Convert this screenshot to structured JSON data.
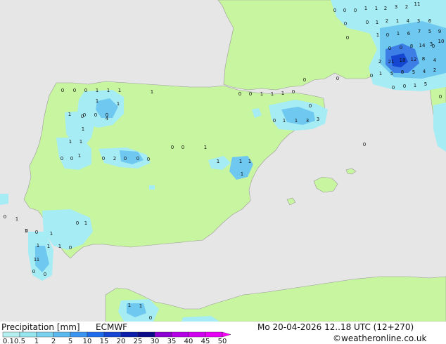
{
  "title": "Precipitation [mm]",
  "model": "ECMWF",
  "valid_time": "Mo 20-04-2026 12..18 UTC (12+270)",
  "credit": "©weatheronline.co.uk",
  "legend": {
    "ticks": [
      "0.1",
      "0.5",
      "1",
      "2",
      "5",
      "10",
      "15",
      "20",
      "25",
      "30",
      "35",
      "40",
      "45",
      "50"
    ],
    "colors": [
      "#b4f0f0",
      "#96e6f0",
      "#78d2f0",
      "#5ab9f0",
      "#3c96f0",
      "#1e6eeb",
      "#1446d2",
      "#0a1eaa",
      "#0a0a87",
      "#8c00d2",
      "#b400e6",
      "#d200f0",
      "#e600f5",
      "#ff00ff"
    ]
  },
  "colors": {
    "sea": "#e6e6e6",
    "land": "#c8f5a0",
    "light_precip": "#a6ecf4",
    "medium_precip": "#6ec8f0",
    "heavy_precip": "#3c7ee6"
  },
  "values": [
    {
      "v": "0"
    },
    {
      "v": "0"
    },
    {
      "v": "0"
    },
    {
      "v": "1"
    },
    {
      "v": "1"
    },
    {
      "v": "2"
    },
    {
      "v": "3"
    },
    {
      "v": "2"
    },
    {
      "v": "11"
    },
    {
      "v": "0"
    },
    {
      "v": "0"
    },
    {
      "v": "1"
    },
    {
      "v": "2"
    },
    {
      "v": "1"
    },
    {
      "v": "4"
    },
    {
      "v": "3"
    },
    {
      "v": "6"
    },
    {
      "v": "1"
    },
    {
      "v": "0"
    },
    {
      "v": "1"
    },
    {
      "v": "6"
    },
    {
      "v": "7"
    },
    {
      "v": "5"
    },
    {
      "v": "9"
    },
    {
      "v": "0"
    },
    {
      "v": "0"
    },
    {
      "v": "0"
    },
    {
      "v": "8"
    },
    {
      "v": "14"
    },
    {
      "v": "3"
    },
    {
      "v": "10"
    },
    {
      "v": "2"
    },
    {
      "v": "21"
    },
    {
      "v": "18"
    },
    {
      "v": "12"
    },
    {
      "v": "8"
    },
    {
      "v": "4"
    },
    {
      "v": "1"
    },
    {
      "v": "5"
    },
    {
      "v": "8"
    },
    {
      "v": "5"
    },
    {
      "v": "4"
    },
    {
      "v": "2"
    },
    {
      "v": "0"
    },
    {
      "v": "0"
    },
    {
      "v": "1"
    },
    {
      "v": "5"
    },
    {
      "v": "0"
    },
    {
      "v": "0"
    },
    {
      "v": "0"
    },
    {
      "v": "0"
    },
    {
      "v": "0"
    },
    {
      "v": "0"
    },
    {
      "v": "0"
    },
    {
      "v": "1"
    },
    {
      "v": "1"
    },
    {
      "v": "1"
    },
    {
      "v": "0"
    },
    {
      "v": "1"
    },
    {
      "v": "0"
    },
    {
      "v": "0"
    },
    {
      "v": "0"
    },
    {
      "v": "4"
    },
    {
      "v": "1"
    },
    {
      "v": "1"
    },
    {
      "v": "0"
    },
    {
      "v": "0"
    },
    {
      "v": "1"
    },
    {
      "v": "1"
    },
    {
      "v": "3"
    },
    {
      "v": "3"
    },
    {
      "v": "0"
    },
    {
      "v": "1"
    },
    {
      "v": "1"
    },
    {
      "v": "1"
    },
    {
      "v": "1"
    },
    {
      "v": "0"
    },
    {
      "v": "2"
    },
    {
      "v": "0"
    },
    {
      "v": "0"
    },
    {
      "v": "0"
    },
    {
      "v": "0"
    },
    {
      "v": "0"
    },
    {
      "v": "1"
    },
    {
      "v": "1"
    },
    {
      "v": "1"
    },
    {
      "v": "1"
    },
    {
      "v": "1"
    },
    {
      "v": "0"
    },
    {
      "v": "0"
    },
    {
      "v": "0"
    },
    {
      "v": "0"
    },
    {
      "v": "1"
    },
    {
      "v": "1"
    },
    {
      "v": "1"
    },
    {
      "v": "1"
    },
    {
      "v": "0"
    },
    {
      "v": "0"
    },
    {
      "v": "0"
    },
    {
      "v": "1"
    },
    {
      "v": "0"
    },
    {
      "v": "1"
    },
    {
      "v": "0"
    },
    {
      "v": "1"
    },
    {
      "v": "1"
    },
    {
      "v": "1"
    },
    {
      "v": "0"
    },
    {
      "v": "0"
    },
    {
      "v": "1"
    },
    {
      "v": "1"
    },
    {
      "v": "1"
    },
    {
      "v": "1"
    },
    {
      "v": "0"
    },
    {
      "v": "0"
    },
    {
      "v": "1"
    },
    {
      "v": "1"
    },
    {
      "v": "0"
    }
  ]
}
